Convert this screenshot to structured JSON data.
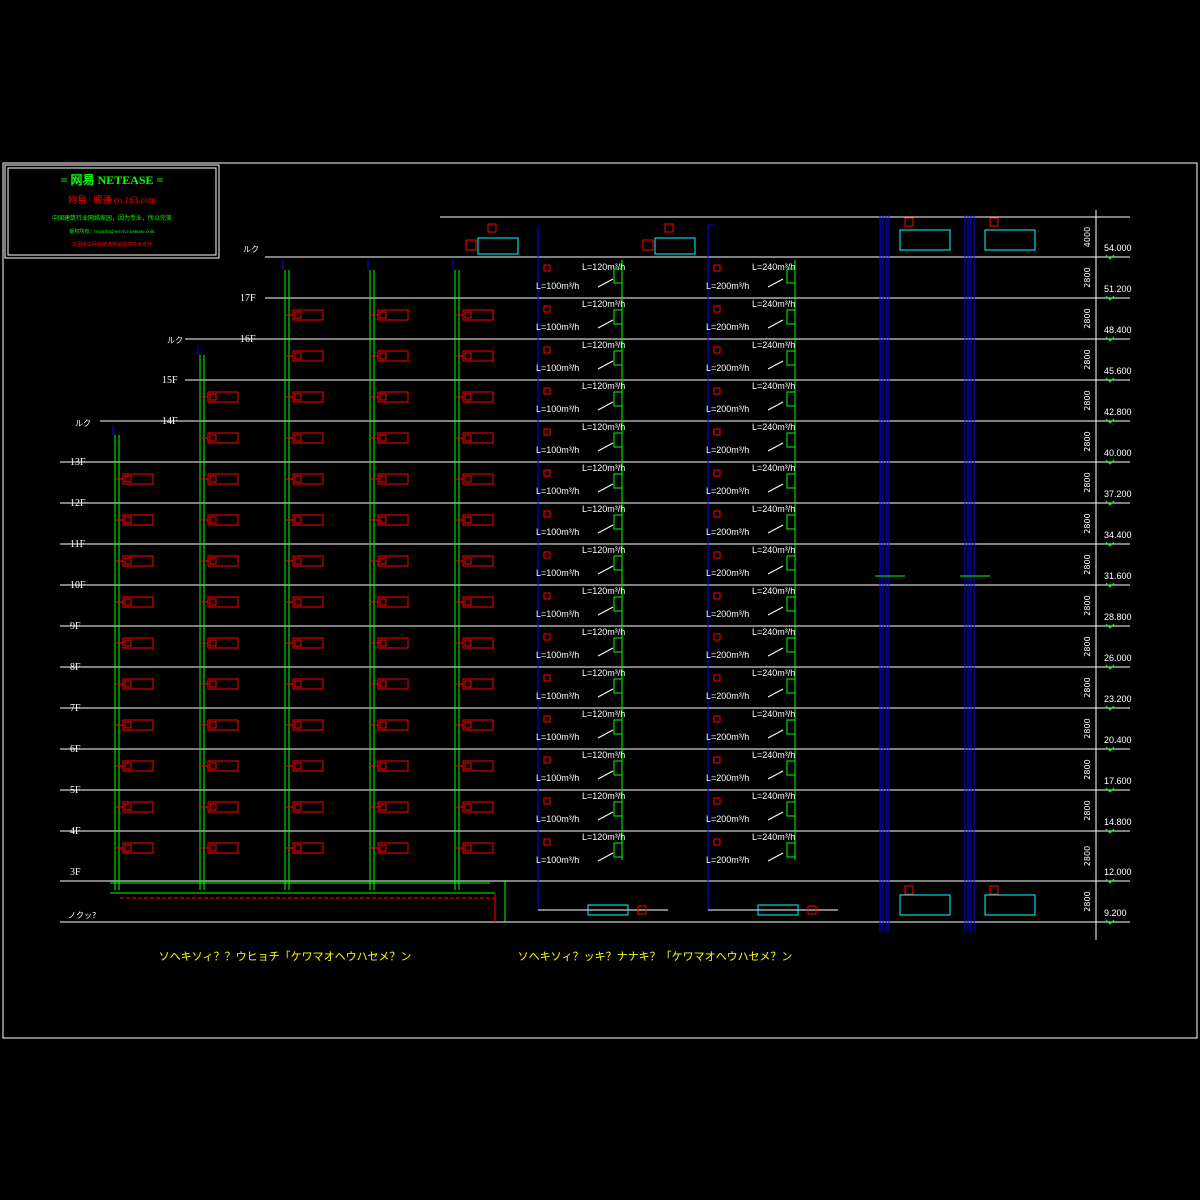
{
  "title_block": {
    "line1": "= 网易  NETEASE =",
    "line2": "网易 · 暖通    co.163.com",
    "line3": "中国建筑行业网络家园，因为专业，所以完美",
    "line4": "版权所有：hvpinfo@service.netease.com",
    "line5": "本图纸由网易暖通频道提供技术支持"
  },
  "captions": {
    "left": "ソヘキソィ？？ウヒョチ「ケワマオヘウハセメ？ン",
    "right": "ソヘキソィ？ッキ？ナナキ？「ケワマオヘウハセメ？ン"
  },
  "floor_labels": [
    "17F",
    "16F",
    "15F",
    "14F",
    "13F",
    "12F",
    "11F",
    "10F",
    "9F",
    "8F",
    "7F",
    "6F",
    "5F",
    "4F",
    "3F"
  ],
  "roof_labels": [
    "ルク",
    "ルク",
    "ルク"
  ],
  "basement_label": "ノクッ?",
  "elevations": [
    "54.000",
    "51.200",
    "48.400",
    "45.600",
    "42.800",
    "40.000",
    "37.200",
    "34.400",
    "31.600",
    "28.800",
    "26.000",
    "23.200",
    "20.400",
    "17.600",
    "14.800",
    "12.000",
    "9.200"
  ],
  "heights": [
    "4000",
    "2800",
    "2800",
    "2800",
    "2800",
    "2800",
    "2800",
    "2800",
    "2800",
    "2800",
    "2800",
    "2800",
    "2800",
    "2800",
    "2800",
    "2800",
    "2800"
  ],
  "airflow": {
    "left_system": {
      "return": "L=100m³/h",
      "supply": "L=120m³/h"
    },
    "right_system": {
      "return": "L=200m³/h",
      "supply": "L=240m³/h"
    }
  },
  "colors": {
    "supply_pipe": "#00ff00",
    "equipment": "#ff0000",
    "riser": "#0000ff",
    "floor_line": "#ffffff",
    "annotation": "#ffff00",
    "fan": "#00ffff",
    "damper": "#ff00ff"
  }
}
